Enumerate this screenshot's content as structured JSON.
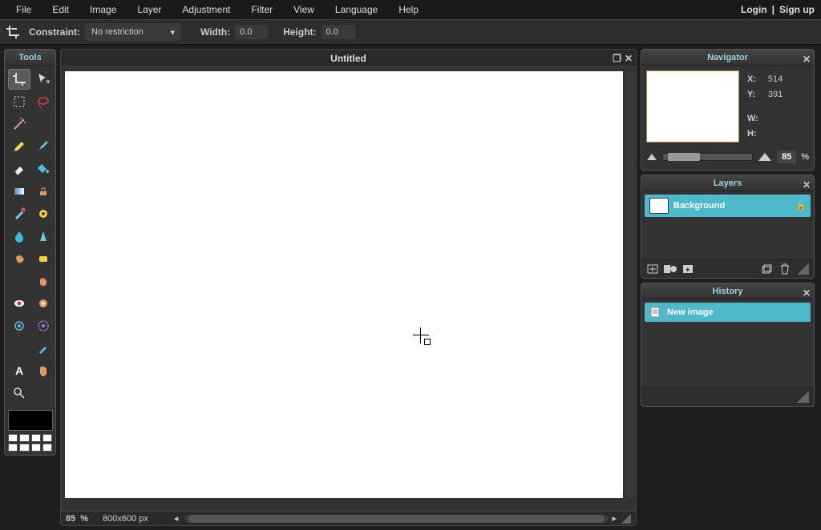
{
  "menu": {
    "items": [
      "File",
      "Edit",
      "Image",
      "Layer",
      "Adjustment",
      "Filter",
      "View",
      "Language",
      "Help"
    ],
    "login": "Login",
    "signup": "Sign up"
  },
  "options": {
    "constraint_label": "Constraint:",
    "constraint_value": "No restriction",
    "width_label": "Width:",
    "width_value": "0.0",
    "height_label": "Height:",
    "height_value": "0.0"
  },
  "tools_panel_title": "Tools",
  "canvas": {
    "title": "Untitled",
    "zoom": "85",
    "zoom_unit": "%",
    "dimensions": "800x600 px"
  },
  "navigator": {
    "title": "Navigator",
    "x_label": "X:",
    "x_val": "514",
    "y_label": "Y:",
    "y_val": "391",
    "w_label": "W:",
    "h_label": "H:",
    "zoom": "85",
    "zoom_unit": "%"
  },
  "layers": {
    "title": "Layers",
    "items": [
      {
        "name": "Background"
      }
    ]
  },
  "history": {
    "title": "History",
    "items": [
      {
        "name": "New image"
      }
    ]
  }
}
